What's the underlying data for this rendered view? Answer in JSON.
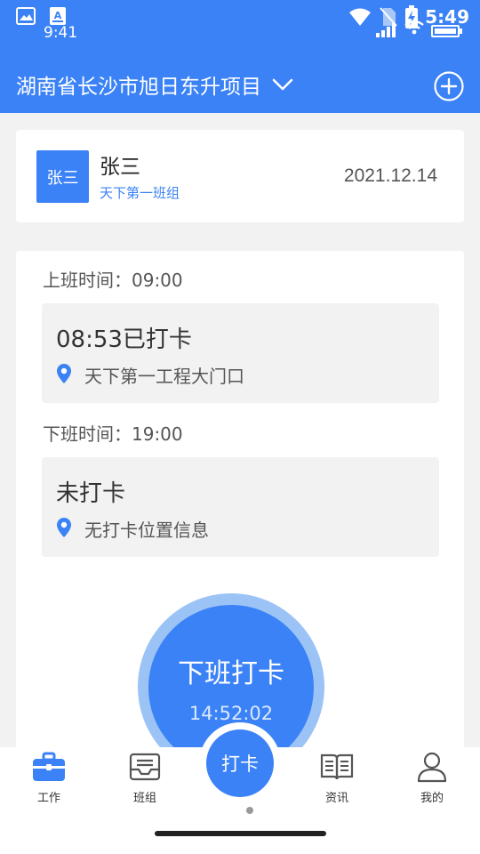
{
  "status_bar": {
    "time_left": "9:41",
    "clock": "5:49"
  },
  "header": {
    "project_title": "湖南省长沙市旭日东升项目"
  },
  "user": {
    "avatar_text": "张三",
    "name": "张三",
    "team": "天下第一班组",
    "date": "2021.12.14"
  },
  "attendance": {
    "on_duty_label": "上班时间：09:00",
    "on_duty_status": "08:53已打卡",
    "on_duty_location": "天下第一工程大门口",
    "off_duty_label": "下班时间：19:00",
    "off_duty_status": "未打卡",
    "off_duty_location": "无打卡位置信息"
  },
  "punch_button": {
    "label": "下班打卡",
    "time": "14:52:02"
  },
  "tabbar": {
    "work": "工作",
    "team": "班组",
    "punch": "打卡",
    "news": "资讯",
    "mine": "我的"
  },
  "colors": {
    "accent": "#3b82f6",
    "ring": "#9cc3f6"
  }
}
